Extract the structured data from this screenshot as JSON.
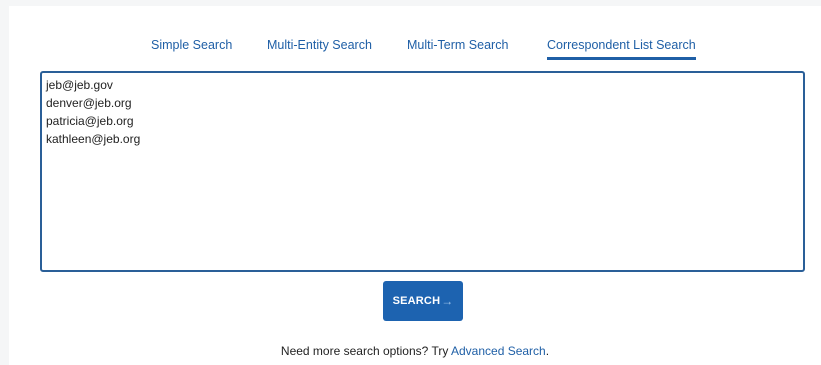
{
  "tabs": [
    {
      "label": "Simple Search",
      "active": false
    },
    {
      "label": "Multi-Entity Search",
      "active": false
    },
    {
      "label": "Multi-Term Search",
      "active": false
    },
    {
      "label": "Correspondent List Search",
      "active": true
    }
  ],
  "correspondent_list": {
    "value": "jeb@jeb.gov\ndenver@jeb.org\npatricia@jeb.org\nkathleen@jeb.org"
  },
  "search_button": {
    "label": "SEARCH",
    "icon": "arrow-right-icon"
  },
  "footer": {
    "prefix": "Need more search options? Try ",
    "link": "Advanced Search",
    "suffix": "."
  },
  "colors": {
    "accent": "#1f5fa6",
    "button": "#1d63b0",
    "border": "#2a5f98"
  }
}
